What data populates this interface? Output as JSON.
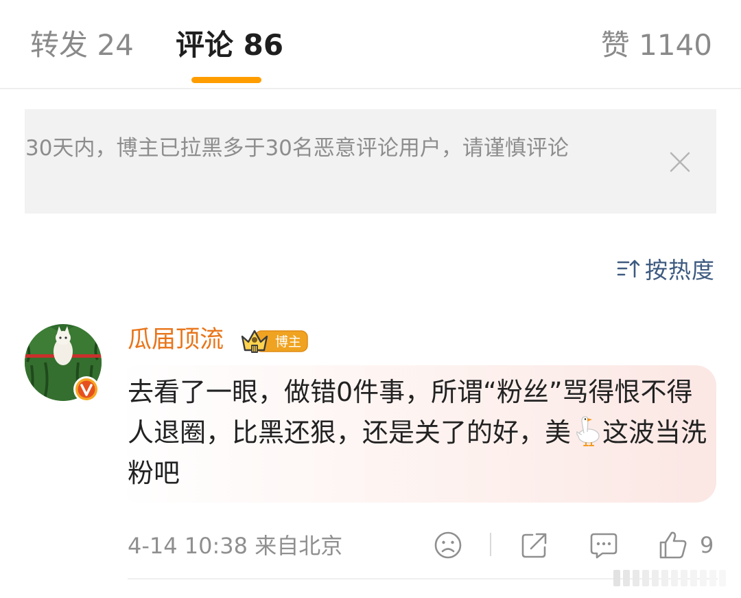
{
  "tabs": {
    "repost": "转发 24",
    "comment": "评论 86",
    "like": "赞 1140"
  },
  "notice": {
    "text": "30天内，博主已拉黑多于30名恶意评论用户，请谨慎评论"
  },
  "sort": {
    "label": "按热度",
    "icon": "sort-icon"
  },
  "comment": {
    "username": "瓜届顶流",
    "badge": "博主",
    "text_before": "去看了一眼，做错0件事，所谓“粉丝”骂得恨不得人退圈，比黑还狠，还是关了的好，美",
    "text_after": "这波当洗粉吧",
    "emoji": "goose-emoji",
    "time": "4-14 10:38",
    "location": "来自北京",
    "like_count": "9"
  },
  "colors": {
    "accent": "#ff9d00",
    "username": "#e8751a",
    "sort_text": "#3d5a80",
    "muted": "#8f8f8f"
  }
}
